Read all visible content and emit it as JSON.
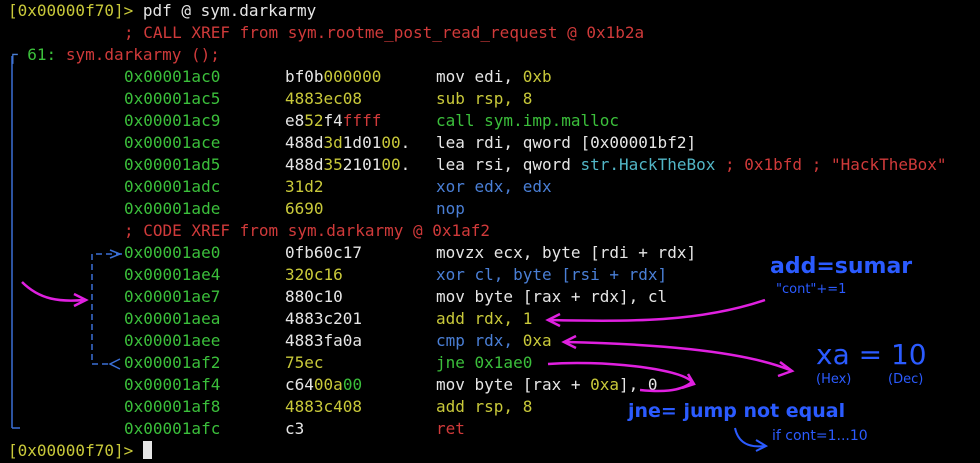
{
  "prompt": {
    "addr": "[0x00000f70]>",
    "command": "pdf @ sym.darkarmy"
  },
  "xref_call": "; CALL XREF from sym.rootme_post_read_request @ 0x1b2a",
  "func_header": {
    "size": "61:",
    "name": "sym.darkarmy ();"
  },
  "xref_code": "; CODE XREF from sym.darkarmy @ 0x1af2",
  "rows": [
    {
      "addr": "0x00001ac0",
      "bytes": [
        {
          "t": "bf0b",
          "c": "white"
        },
        {
          "t": "000000",
          "c": "yellow"
        }
      ],
      "ins": [
        {
          "t": "mov edi, ",
          "c": "white"
        },
        {
          "t": "0xb",
          "c": "yellow"
        }
      ]
    },
    {
      "addr": "0x00001ac5",
      "bytes": [
        {
          "t": "4883ec08",
          "c": "yellow"
        }
      ],
      "ins": [
        {
          "t": "sub rsp, 8",
          "c": "yellow"
        }
      ]
    },
    {
      "addr": "0x00001ac9",
      "bytes": [
        {
          "t": "e8",
          "c": "white"
        },
        {
          "t": "52",
          "c": "yellow"
        },
        {
          "t": "f4",
          "c": "white"
        },
        {
          "t": "ffff",
          "c": "red"
        }
      ],
      "ins": [
        {
          "t": "call sym.imp.malloc",
          "c": "green"
        }
      ]
    },
    {
      "addr": "0x00001ace",
      "bytes": [
        {
          "t": "488d",
          "c": "white"
        },
        {
          "t": "3d",
          "c": "yellow"
        },
        {
          "t": "1d01",
          "c": "white"
        },
        {
          "t": "00",
          "c": "yellow"
        },
        {
          "t": ".",
          "c": "white"
        }
      ],
      "ins": [
        {
          "t": "lea rdi, qword [0x00001bf2]",
          "c": "white"
        }
      ]
    },
    {
      "addr": "0x00001ad5",
      "bytes": [
        {
          "t": "488d",
          "c": "white"
        },
        {
          "t": "35",
          "c": "yellow"
        },
        {
          "t": "2101",
          "c": "white"
        },
        {
          "t": "00",
          "c": "yellow"
        },
        {
          "t": ".",
          "c": "white"
        }
      ],
      "ins": [
        {
          "t": "lea rsi, qword ",
          "c": "white"
        },
        {
          "t": "str.HackTheBox",
          "c": "cyan"
        },
        {
          "t": " ; 0x1bfd ; \"HackTheBox\"",
          "c": "red"
        }
      ]
    },
    {
      "addr": "0x00001adc",
      "bytes": [
        {
          "t": "31d2",
          "c": "yellow"
        }
      ],
      "ins": [
        {
          "t": "xor edx, edx",
          "c": "blue"
        }
      ]
    },
    {
      "addr": "0x00001ade",
      "bytes": [
        {
          "t": "6690",
          "c": "yellow"
        }
      ],
      "ins": [
        {
          "t": "nop",
          "c": "blue"
        }
      ]
    },
    {
      "addr": "0x00001ae0",
      "bytes": [
        {
          "t": "0fb60c17",
          "c": "white"
        }
      ],
      "ins": [
        {
          "t": "movzx ecx, byte [rdi + rdx]",
          "c": "white"
        }
      ]
    },
    {
      "addr": "0x00001ae4",
      "bytes": [
        {
          "t": "320c16",
          "c": "yellow"
        }
      ],
      "ins": [
        {
          "t": "xor cl, byte [rsi + rdx]",
          "c": "blue"
        }
      ]
    },
    {
      "addr": "0x00001ae7",
      "bytes": [
        {
          "t": "880c10",
          "c": "white"
        }
      ],
      "ins": [
        {
          "t": "mov byte [rax + rdx], cl",
          "c": "white"
        }
      ]
    },
    {
      "addr": "0x00001aea",
      "bytes": [
        {
          "t": "4883c201",
          "c": "white"
        }
      ],
      "ins": [
        {
          "t": "add rdx, 1",
          "c": "yellow"
        }
      ]
    },
    {
      "addr": "0x00001aee",
      "bytes": [
        {
          "t": "4883fa0a",
          "c": "white"
        }
      ],
      "ins": [
        {
          "t": "cmp rdx, ",
          "c": "blue"
        },
        {
          "t": "0xa",
          "c": "yellow"
        }
      ]
    },
    {
      "addr": "0x00001af2",
      "bytes": [
        {
          "t": "75ec",
          "c": "yellow"
        }
      ],
      "ins": [
        {
          "t": "jne 0x1ae0",
          "c": "green"
        }
      ]
    },
    {
      "addr": "0x00001af4",
      "bytes": [
        {
          "t": "c64",
          "c": "white"
        },
        {
          "t": "00a",
          "c": "yellow"
        },
        {
          "t": "00",
          "c": "green"
        }
      ],
      "ins": [
        {
          "t": "mov byte [rax + ",
          "c": "white"
        },
        {
          "t": "0xa",
          "c": "yellow"
        },
        {
          "t": "], 0",
          "c": "white"
        }
      ]
    },
    {
      "addr": "0x00001af8",
      "bytes": [
        {
          "t": "4883c408",
          "c": "yellow"
        }
      ],
      "ins": [
        {
          "t": "add rsp, 8",
          "c": "yellow"
        }
      ]
    },
    {
      "addr": "0x00001afc",
      "bytes": [
        {
          "t": "c3",
          "c": "white"
        }
      ],
      "ins": [
        {
          "t": "ret",
          "c": "red"
        }
      ]
    }
  ],
  "end_prompt": "[0x00000f70]>",
  "annotations": {
    "add": "add=sumar",
    "cont": "\"cont\"+=1",
    "xa": "xa = 10",
    "hex": "(Hex)",
    "dec": "(Dec)",
    "jne": "jne= jump not equal",
    "if": "if cont=1...10"
  },
  "colors": {
    "magenta": "#e020e0",
    "annotation_blue": "#2b5bff",
    "graph_blue": "#3a6fd6"
  }
}
